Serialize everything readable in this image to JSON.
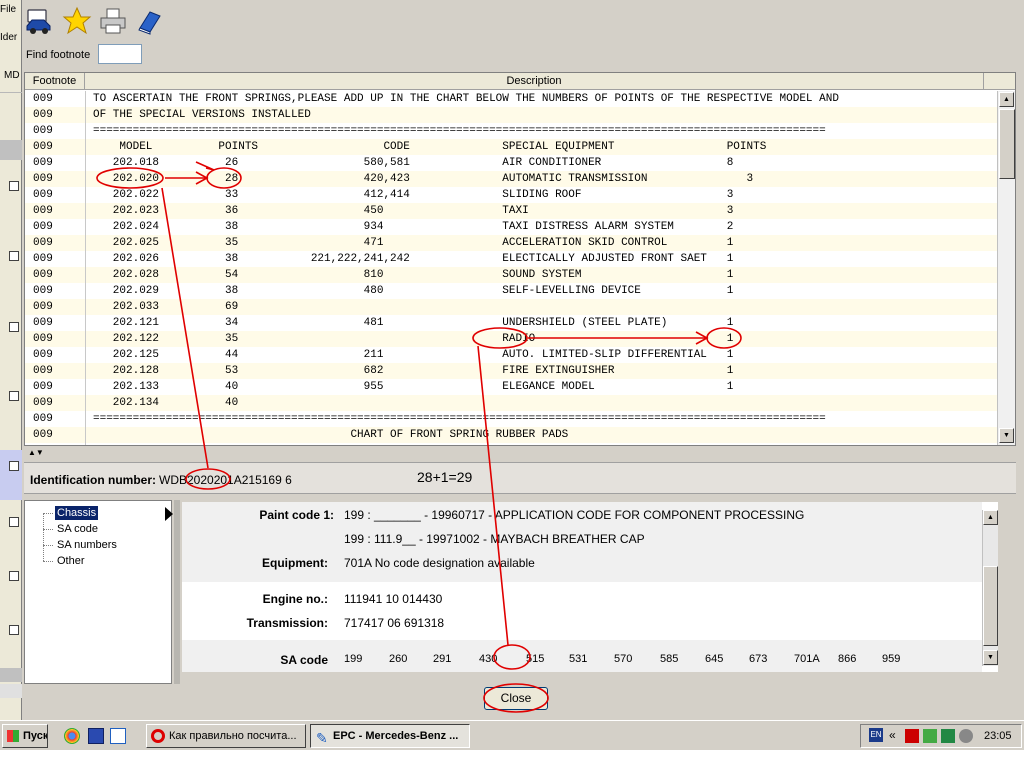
{
  "bg_window": {
    "menu_items": [
      "File",
      "Ider",
      "MD"
    ]
  },
  "toolbar": {
    "icons": [
      "car-icon",
      "star-icon",
      "printer-icon",
      "book-icon"
    ]
  },
  "find": {
    "label": "Find footnote",
    "value": ""
  },
  "footnote_table": {
    "columns": [
      "Footnote",
      "Description"
    ],
    "rows": [
      {
        "fn": "009",
        "desc": "TO ASCERTAIN THE FRONT SPRINGS,PLEASE ADD UP IN THE CHART BELOW THE NUMBERS OF POINTS OF THE RESPECTIVE MODEL AND"
      },
      {
        "fn": "009",
        "desc": "OF THE SPECIAL VERSIONS INSTALLED"
      },
      {
        "fn": "009",
        "desc": "==============================================================================================================="
      },
      {
        "fn": "009",
        "desc": "    MODEL          POINTS                   CODE              SPECIAL EQUIPMENT                 POINTS"
      },
      {
        "fn": "009",
        "desc": "   202.018          26                   580,581              AIR CONDITIONER                   8"
      },
      {
        "fn": "009",
        "desc": "   202.020          28                   420,423              AUTOMATIC TRANSMISSION               3"
      },
      {
        "fn": "009",
        "desc": "   202.022          33                   412,414              SLIDING ROOF                      3"
      },
      {
        "fn": "009",
        "desc": "   202.023          36                   450                  TAXI                              3"
      },
      {
        "fn": "009",
        "desc": "   202.024          38                   934                  TAXI DISTRESS ALARM SYSTEM        2"
      },
      {
        "fn": "009",
        "desc": "   202.025          35                   471                  ACCELERATION SKID CONTROL         1"
      },
      {
        "fn": "009",
        "desc": "   202.026          38           221,222,241,242              ELECTICALLY ADJUSTED FRONT SAET   1"
      },
      {
        "fn": "009",
        "desc": "   202.028          54                   810                  SOUND SYSTEM                      1"
      },
      {
        "fn": "009",
        "desc": "   202.029          38                   480                  SELF-LEVELLING DEVICE             1"
      },
      {
        "fn": "009",
        "desc": "   202.033          69"
      },
      {
        "fn": "009",
        "desc": "   202.121          34                   481                  UNDERSHIELD (STEEL PLATE)         1"
      },
      {
        "fn": "009",
        "desc": "   202.122          35                                        RADIO                             1"
      },
      {
        "fn": "009",
        "desc": "   202.125          44                   211                  AUTO. LIMITED-SLIP DIFFERENTIAL   1"
      },
      {
        "fn": "009",
        "desc": "   202.128          53                   682                  FIRE EXTINGUISHER                 1"
      },
      {
        "fn": "009",
        "desc": "   202.133          40                   955                  ELEGANCE MODEL                    1"
      },
      {
        "fn": "009",
        "desc": "   202.134          40"
      },
      {
        "fn": "009",
        "desc": "==============================================================================================================="
      },
      {
        "fn": "009",
        "desc": "                                       CHART OF FRONT SPRING RUBBER PADS"
      },
      {
        "fn": "009",
        "desc": ""
      }
    ]
  },
  "identification": {
    "label": "Identification number:",
    "prefix": "WDB",
    "highlight": "202020",
    "suffix": "1A215169 6"
  },
  "annotation_sum": "28+1=29",
  "tree": {
    "items": [
      "Chassis",
      "SA code",
      "SA numbers",
      "Other"
    ]
  },
  "details": {
    "paint_label": "Paint code 1:",
    "paint_lines": [
      "199   : _______ - 19960717 - APPLICATION CODE FOR COMPONENT PROCESSING",
      "199   : 111.9__ - 19971002 - MAYBACH BREATHER CAP"
    ],
    "equipment_label": "Equipment:",
    "equipment_value": "701A No code designation available",
    "engine_label": "Engine no.:",
    "engine_value": "111941 10 014430",
    "transmission_label": "Transmission:",
    "transmission_value": "717417 06 691318",
    "sa_label": "SA code",
    "sa_codes": [
      "199",
      "260",
      "291",
      "430",
      "515",
      "531",
      "570",
      "585",
      "645",
      "673",
      "701A",
      "866",
      "959"
    ]
  },
  "close_label": "Close",
  "taskbar": {
    "start_label": "Пуск",
    "tasks": [
      {
        "label": "Как правильно посчита...",
        "active": false
      },
      {
        "label": "EPC - Mercedes-Benz ...",
        "active": true
      }
    ],
    "lang": "EN",
    "clock": "23:05"
  },
  "colors": {
    "annotation_red": "#e00000",
    "row_odd": "#fffbe8",
    "tree_selected": "#0a246a",
    "detail_band": "#f0f0f0"
  }
}
